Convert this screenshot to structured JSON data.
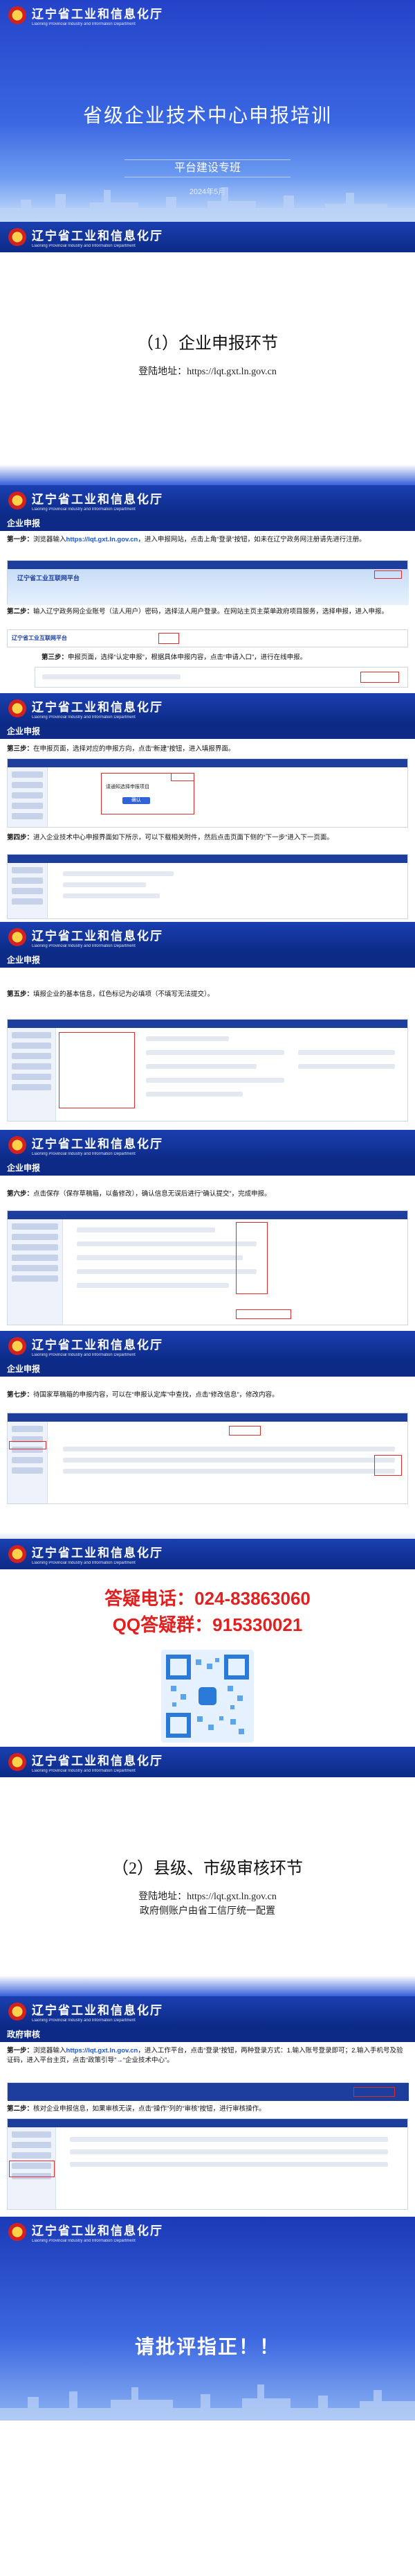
{
  "header": {
    "title": "辽宁省工业和信息化厅",
    "subtitle": "Liaoning Provincial Industry and Information Department"
  },
  "cover": {
    "title": "省级企业技术中心申报培训",
    "tag": "平台建设专班",
    "date": "2024年5月"
  },
  "section1": {
    "title": "（1）企业申报环节",
    "url": "登陆地址：https://lqt.gxt.ln.gov.cn"
  },
  "step1": {
    "bar": "企业申报",
    "p1_label": "第一步：",
    "p1_a": "浏览器输入",
    "p1_link": "https://lqt.gxt.ln.gov.cn",
    "p1_b": "，进入申报网站，点击上角“登录”按钮，如未在辽宁政务网注册请先进行注册。",
    "p2_label": "第二步：",
    "p2": "输入辽宁政务网企业账号（法人用户）密码，选择法人用户登录。在网站主页主菜单政府项目服务，选择申报，进入申报。",
    "p3_label": "第三步：",
    "p3": "申报页面，选择“认定申报”，根据具体申报内容，点击“申请入口”，进行在线申报。",
    "site_name": "辽宁省工业互联网平台"
  },
  "step2": {
    "bar": "企业申报",
    "p1_label": "第三步：",
    "p1": "在申报页面，选择对应的申报方向，点击“新建”按钮，进入填报界面。",
    "p2_label": "第四步：",
    "p2": "进入企业技术中心申报界面如下所示，可以下载相关附件，然后点击页面下侧的“下一步”进入下一页面。",
    "dialog_title": "请通知选择申报项目",
    "dialog_btn": "确认"
  },
  "step3": {
    "bar": "企业申报",
    "p1_label": "第五步：",
    "p1": "填报企业的基本信息，红色标记为必填项（不填写无法提交）。"
  },
  "step4": {
    "bar": "企业申报",
    "p1_label": "第六步：",
    "p1": "点击保存（保存草稿箱，以备修改），确认信息无误后进行“确认提交”，完成申报。"
  },
  "step5": {
    "bar": "企业申报",
    "p1_label": "第七步：",
    "p1": "待国家草稿箱的申报内容，可以在“申报认定库”中查找，点击“修改信息”，修改内容。"
  },
  "qr": {
    "phone": "答疑电话：024-83863060",
    "qq": "QQ答疑群：915330021"
  },
  "section2": {
    "title": "（2）县级、市级审核环节",
    "url": "登陆地址：https://lqt.gxt.ln.gov.cn",
    "url2": "政府侧账户由省工信厅统一配置"
  },
  "gov": {
    "bar": "政府审核",
    "p1_label": "第一步：",
    "p1_a": "浏览器输入",
    "p1_link": "https://lqt.gxt.ln.gov.cn",
    "p1_b": "，进入工作平台，点击“登录”按钮，两种登录方式：1.输入账号登录即可；2.输入手机号及验证码，进入平台主页，点击“政策引导”→“企业技术中心”。",
    "p2_label": "第二步：",
    "p2": "核对企业申报信息，如果审核无误，点击“操作”列的“审核”按钮，进行审核操作。"
  },
  "ending": {
    "text": "请批评指正！！"
  }
}
